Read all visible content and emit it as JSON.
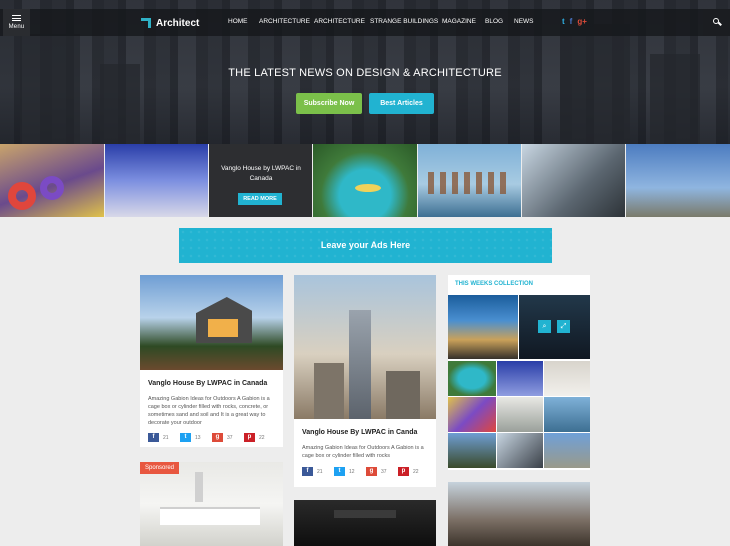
{
  "header": {
    "menu_label": "Menu",
    "logo_text": "Architect",
    "nav": [
      "HOME",
      "ARCHITECTURE",
      "ARCHITECTURE",
      "STRANGE BUILDINGS",
      "MAGAZINE",
      "BLOG",
      "NEWS"
    ],
    "social_icons": [
      "twitter-icon",
      "facebook-icon",
      "google-plus-icon"
    ],
    "search_icon": "search-icon"
  },
  "hero": {
    "headline": "THE LATEST NEWS ON DESIGN & ARCHITECTURE",
    "subscribe_label": "Subscribe Now",
    "best_articles_label": "Best Articles"
  },
  "strip": {
    "overlay_title": "Vanglo House by LWPAC in Canada",
    "read_more": "READ MORE"
  },
  "ad": {
    "label": "Leave your Ads Here"
  },
  "cards": [
    {
      "title": "Vanglo House By LWPAC in Canada",
      "excerpt": "Amazing Gabion Ideas for Outdoors A Gabion is a cage box or cylinder filled with rocks, concrete, or sometimes sand and soil and It is a great way to decorate your outdoor",
      "shares": {
        "facebook": "21",
        "twitter": "13",
        "googleplus": "37",
        "pinterest": "22"
      }
    },
    {
      "title": "Vanglo House By LWPAC in Canda",
      "excerpt": "Amazing Gabion Ideas for Outdoors A Gabion is a cage box or cylinder filled with rocks",
      "shares": {
        "facebook": "21",
        "twitter": "12",
        "googleplus": "37",
        "pinterest": "22"
      }
    }
  ],
  "sponsored_label": "Sponsored",
  "collection": {
    "heading": "THIS WEEKS COLLECTION"
  },
  "colors": {
    "accent": "#21b3d1",
    "green": "#7bc04a",
    "sponsored": "#e8573f"
  }
}
